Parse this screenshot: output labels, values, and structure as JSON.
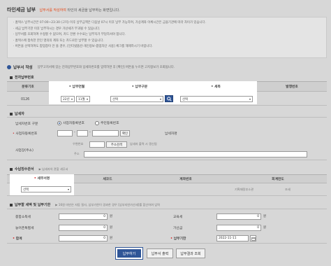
{
  "header": {
    "title": "타인세금 납부",
    "subtitle_prefix": "납부서를 작성하여",
    "subtitle_suffix": "타인의 세금을 납부하는 화면입니다."
  },
  "notice": [
    "· 홈택스 납부시간은 07:00~23:30 (고지) 이후 납부금액은 다음날 07시 이후 납부 가능하며, 가상계좌 이체시간은 금융기관에 따라 차이가 있습니다.",
    "· 세금 납부기한 이후 납부하시는 경우 가산세가 부과될 수 있습니다.",
    "· 납부서를 조회하여 수정할 수 없으며, 카드 전환 수수료는 납부자가 부담하셔야 합니다.",
    "· 홈택스에 접속한 본인 명의의 계좌 또는 카드로만 납부할 수 있습니다.",
    "· 버튼을 선택하여도 팝업창이 안 뜰 경우, [인터넷옵션-개인정보-팝업차단 사용] 체크를 해제하시기 바랍니다."
  ],
  "payment_input": {
    "heading": "납부서 작성",
    "hint": "납부고지서에 있는 전자납부번호와 납세자번호를 입력하면 후 [확인] 버튼을 누르면 고지정보가 조회됩니다."
  },
  "e_payment": {
    "heading": "전자납부번호",
    "columns": [
      "분류기호",
      "납부연월",
      "납부구분",
      "세목",
      "발행번호"
    ],
    "row": {
      "code": "0126",
      "year": "22년",
      "month": "11월",
      "type": "선택",
      "tax_item": "선택"
    }
  },
  "taxpayer": {
    "heading": "납세자",
    "id_type_label": "납세자번호 구분",
    "radio_business": "사업자등록번호",
    "radio_resident": "주민등록번호",
    "biz_no_label": "사업자등록번호",
    "confirm_button": "확인",
    "name_label": "납세자명",
    "address_label": "사업장(주소)",
    "zipcode_label": "우편번호",
    "address_search_button": "주소검색",
    "address_hint": "납세자 출력 시 갱신됨",
    "address_sub_label": "주소"
  },
  "collector": {
    "heading": "수납징수관서",
    "hint": "납세자의 관할 세무서",
    "columns": [
      "세무서명",
      "세코드",
      "계좌번호",
      "회계연도"
    ],
    "row": {
      "office_select": "선택",
      "account_suffix": "기획재정부소관",
      "fiscal": "조세"
    }
  },
  "amount": {
    "heading": "납부할 세액 및 납부기한",
    "hint": "16원 미만은 자동 절사, 납부기한이 경과한 경우 [납부지연가산세]를 합산하여 입력",
    "hint_link": "납부지연가산세",
    "national_tax_label": "종합소득세",
    "rural_tax_label": "농어촌특별세",
    "total_label": "합계",
    "education_label": "교육세",
    "penalty_label": "가산금",
    "due_label": "납부기한",
    "national_tax": "0",
    "rural_tax": "0",
    "total": "0",
    "education": "0",
    "penalty": "0",
    "due_date": "2022-11-11",
    "won": "원"
  },
  "buttons": {
    "pay": "납부하기",
    "print": "납부서 출력",
    "result": "납부결과 조회"
  },
  "colors": {
    "accent": "#2f5597",
    "highlight": "#e64a19"
  }
}
